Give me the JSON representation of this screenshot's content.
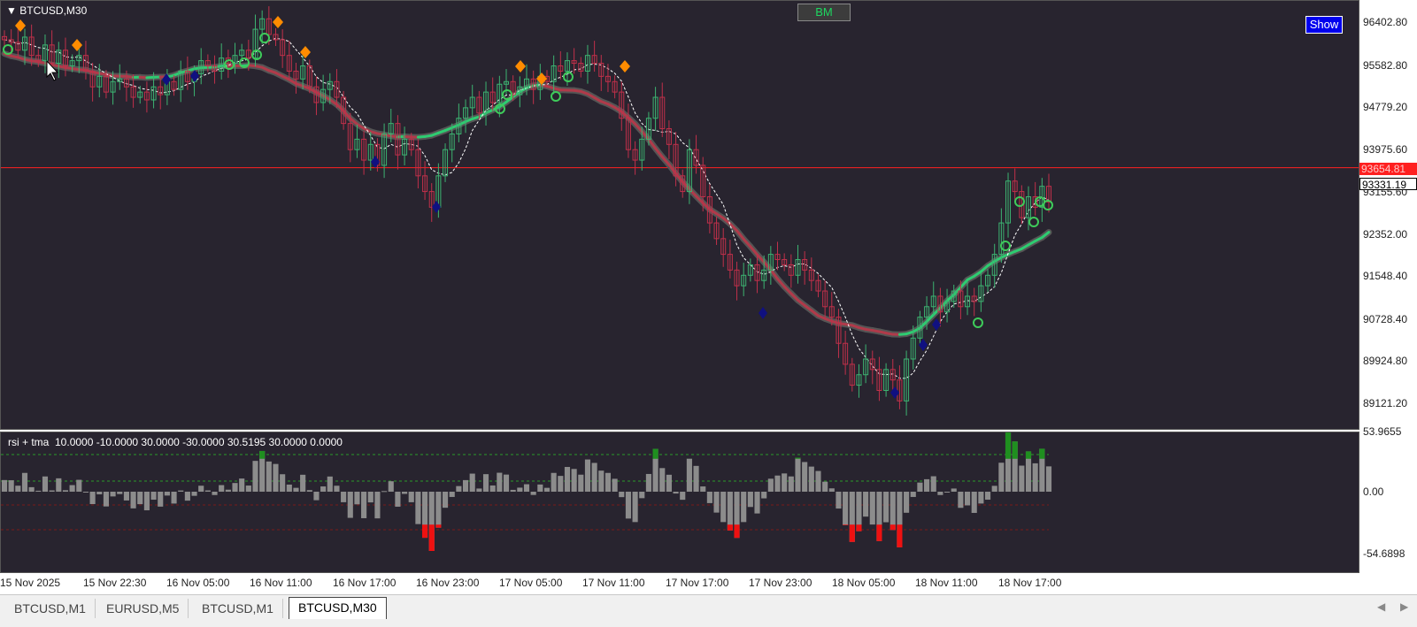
{
  "chart": {
    "symbol": "BTCUSD,M30",
    "bm_label": "BM",
    "show_label": "Show",
    "current_price": "93654.81",
    "ask_price": "93331.19",
    "colors": {
      "background": "#28242f",
      "bull": "#3cb371",
      "bear": "#c0304a",
      "price_line": "#ff2020",
      "tma_up": "#2ecc71",
      "tma_down": "#b03a4a",
      "diamond_orange": "#ff8c00",
      "diamond_navy": "#101080"
    }
  },
  "price_axis": [
    "96402.80",
    "95582.80",
    "94779.20",
    "93975.60",
    "93155.60",
    "92352.00",
    "91548.40",
    "90728.40",
    "89924.80",
    "89121.20"
  ],
  "indicator": {
    "label": "rsi + tma  10.0000 -10.0000 30.0000 -30.0000 30.5195 30.0000 0.0000",
    "axis": [
      "53.9655",
      "0.00",
      "-54.6898"
    ]
  },
  "time_axis": [
    "15 Nov 2025",
    "15 Nov 22:30",
    "16 Nov 05:00",
    "16 Nov 11:00",
    "16 Nov 17:00",
    "16 Nov 23:00",
    "17 Nov 05:00",
    "17 Nov 11:00",
    "17 Nov 17:00",
    "17 Nov 23:00",
    "18 Nov 05:00",
    "18 Nov 11:00",
    "18 Nov 17:00"
  ],
  "tabs": [
    {
      "label": "BTCUSD,M1"
    },
    {
      "label": "EURUSD,M5"
    },
    {
      "label": "BTCUSD,M1"
    },
    {
      "label": "BTCUSD,M30"
    }
  ],
  "active_tab": 3,
  "chart_data": {
    "type": "candlestick",
    "closes": [
      96100,
      96050,
      95900,
      96150,
      95800,
      95700,
      96000,
      95650,
      95900,
      95600,
      95700,
      95800,
      95500,
      95200,
      95400,
      95100,
      95300,
      95350,
      95200,
      95000,
      95100,
      94950,
      95200,
      95050,
      95300,
      95150,
      95500,
      95300,
      95450,
      95700,
      95600,
      95500,
      95750,
      95650,
      95800,
      95900,
      95750,
      96300,
      96500,
      96200,
      96100,
      95800,
      95500,
      95350,
      95600,
      95200,
      94900,
      95150,
      95300,
      95000,
      94500,
      94000,
      94200,
      93800,
      94100,
      93700,
      94300,
      94500,
      93900,
      94200,
      94000,
      93500,
      93200,
      92900,
      93500,
      94000,
      94300,
      94600,
      94800,
      95000,
      94700,
      95100,
      94900,
      95250,
      95300,
      95050,
      95200,
      95350,
      95150,
      95400,
      95300,
      95600,
      95500,
      95700,
      95650,
      95500,
      95800,
      95650,
      95400,
      95300,
      95100,
      94600,
      94000,
      93800,
      94200,
      94600,
      95000,
      94400,
      94100,
      93500,
      93200,
      94000,
      93700,
      93100,
      92600,
      92300,
      92000,
      91700,
      91400,
      91600,
      91800,
      91500,
      91700,
      92000,
      91900,
      91800,
      91600,
      91900,
      91700,
      91500,
      91300,
      91000,
      90800,
      90300,
      89900,
      89500,
      89700,
      90000,
      89800,
      89400,
      89800,
      89600,
      89200,
      90000,
      90400,
      90800,
      91000,
      91200,
      90900,
      91100,
      91300,
      91000,
      91200,
      91100,
      91400,
      91600,
      92000,
      92600,
      93400,
      93200,
      92700,
      93100,
      92900,
      93300,
      93000
    ]
  }
}
